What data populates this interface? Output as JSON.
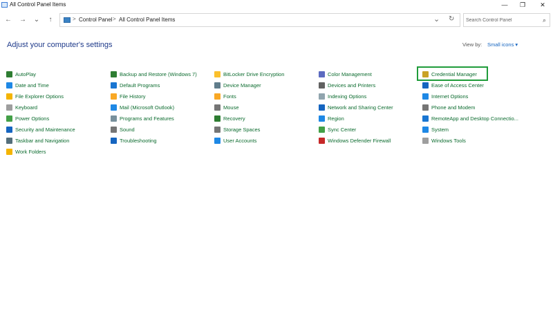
{
  "window": {
    "title": "All Control Panel Items",
    "minimize_glyph": "—",
    "maximize_glyph": "❐",
    "close_glyph": "✕"
  },
  "nav": {
    "back_glyph": "←",
    "forward_glyph": "→",
    "recent_glyph": "⌄",
    "up_glyph": "↑",
    "dropdown_glyph": "⌄",
    "refresh_glyph": "↻"
  },
  "breadcrumb": {
    "separator": ">",
    "items": [
      "Control Panel",
      "All Control Panel Items"
    ]
  },
  "search": {
    "placeholder": "Search Control Panel",
    "icon_glyph": "⌕"
  },
  "heading": "Adjust your computer's settings",
  "view_by": {
    "label": "View by:",
    "value": "Small icons ▾"
  },
  "columns": [
    [
      {
        "label": "AutoPlay",
        "icon": "autoplay-icon",
        "color": "#2e7d32"
      },
      {
        "label": "Date and Time",
        "icon": "clock-icon",
        "color": "#1e88e5"
      },
      {
        "label": "File Explorer Options",
        "icon": "folder-icon",
        "color": "#f4b400"
      },
      {
        "label": "Keyboard",
        "icon": "keyboard-icon",
        "color": "#9e9e9e"
      },
      {
        "label": "Power Options",
        "icon": "power-icon",
        "color": "#43a047"
      },
      {
        "label": "Security and Maintenance",
        "icon": "flag-icon",
        "color": "#1565c0"
      },
      {
        "label": "Taskbar and Navigation",
        "icon": "taskbar-icon",
        "color": "#546e7a"
      },
      {
        "label": "Work Folders",
        "icon": "folder-icon",
        "color": "#f4b400"
      }
    ],
    [
      {
        "label": "Backup and Restore (Windows 7)",
        "icon": "backup-icon",
        "color": "#2e7d32"
      },
      {
        "label": "Default Programs",
        "icon": "programs-icon",
        "color": "#1976d2"
      },
      {
        "label": "File History",
        "icon": "history-icon",
        "color": "#f9a825"
      },
      {
        "label": "Mail (Microsoft Outlook)",
        "icon": "mail-icon",
        "color": "#1e88e5"
      },
      {
        "label": "Programs and Features",
        "icon": "features-icon",
        "color": "#78909c"
      },
      {
        "label": "Sound",
        "icon": "speaker-icon",
        "color": "#757575"
      },
      {
        "label": "Troubleshooting",
        "icon": "troubleshoot-icon",
        "color": "#1565c0"
      }
    ],
    [
      {
        "label": "BitLocker Drive Encryption",
        "icon": "bitlocker-icon",
        "color": "#fbc02d"
      },
      {
        "label": "Device Manager",
        "icon": "device-manager-icon",
        "color": "#607d8b"
      },
      {
        "label": "Fonts",
        "icon": "fonts-icon",
        "color": "#f9a825"
      },
      {
        "label": "Mouse",
        "icon": "mouse-icon",
        "color": "#757575"
      },
      {
        "label": "Recovery",
        "icon": "recovery-icon",
        "color": "#2e7d32"
      },
      {
        "label": "Storage Spaces",
        "icon": "storage-icon",
        "color": "#757575"
      },
      {
        "label": "User Accounts",
        "icon": "user-icon",
        "color": "#1e88e5"
      }
    ],
    [
      {
        "label": "Color Management",
        "icon": "color-icon",
        "color": "#5c6bc0"
      },
      {
        "label": "Devices and Printers",
        "icon": "printer-icon",
        "color": "#616161"
      },
      {
        "label": "Indexing Options",
        "icon": "indexing-icon",
        "color": "#90a4ae"
      },
      {
        "label": "Network and Sharing Center",
        "icon": "network-icon",
        "color": "#1565c0"
      },
      {
        "label": "Region",
        "icon": "globe-icon",
        "color": "#1e88e5"
      },
      {
        "label": "Sync Center",
        "icon": "sync-icon",
        "color": "#43a047"
      },
      {
        "label": "Windows Defender Firewall",
        "icon": "firewall-icon",
        "color": "#c62828"
      }
    ],
    [
      {
        "label": "Credential Manager",
        "icon": "credential-icon",
        "color": "#c9a227"
      },
      {
        "label": "Ease of Access Center",
        "icon": "ease-of-access-icon",
        "color": "#1565c0"
      },
      {
        "label": "Internet Options",
        "icon": "internet-icon",
        "color": "#1e88e5"
      },
      {
        "label": "Phone and Modem",
        "icon": "phone-icon",
        "color": "#757575"
      },
      {
        "label": "RemoteApp and Desktop Connectio...",
        "icon": "remote-icon",
        "color": "#1976d2"
      },
      {
        "label": "System",
        "icon": "system-icon",
        "color": "#1e88e5"
      },
      {
        "label": "Windows Tools",
        "icon": "tools-icon",
        "color": "#9e9e9e"
      }
    ]
  ],
  "highlight_color": "#1f9c3a"
}
